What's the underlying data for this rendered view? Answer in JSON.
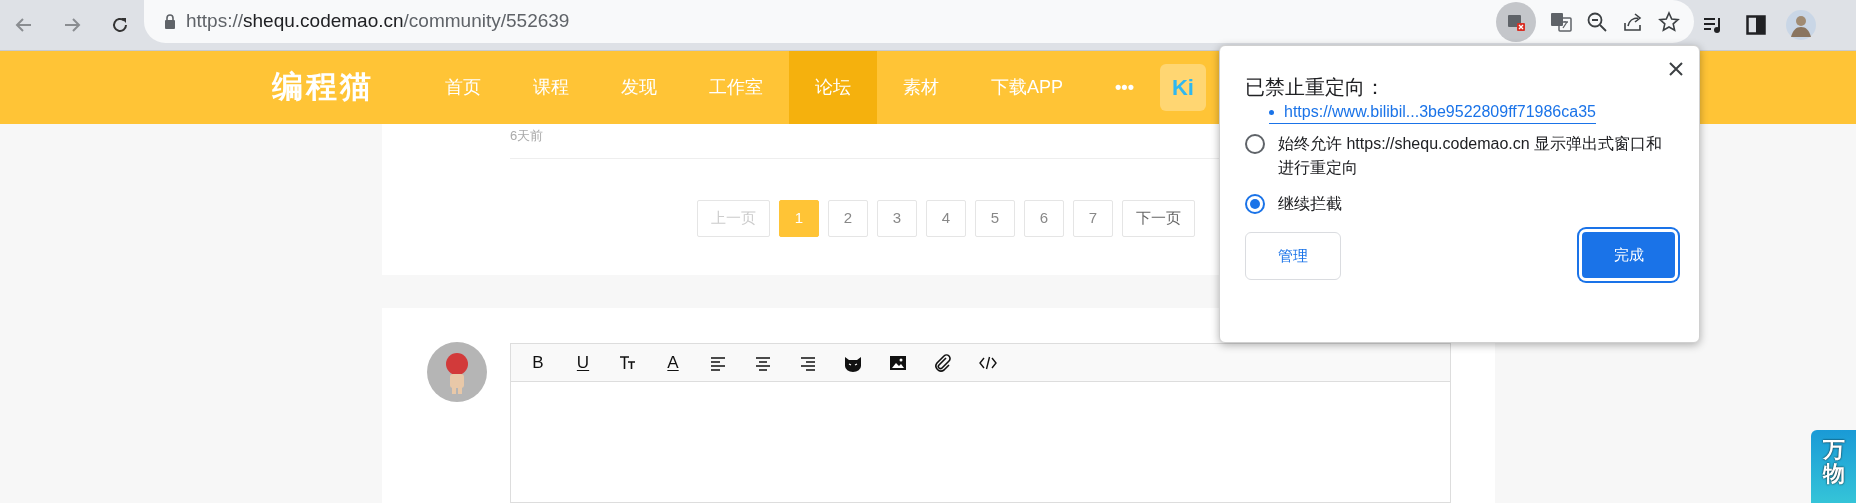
{
  "browser": {
    "url_scheme": "https://",
    "url_host": "shequ.codemao.cn",
    "url_path": "/community/552639"
  },
  "nav": {
    "logo": "编程猫",
    "items": [
      {
        "label": "首页",
        "selected": false
      },
      {
        "label": "课程",
        "selected": false
      },
      {
        "label": "发现",
        "selected": false
      },
      {
        "label": "工作室",
        "selected": false
      },
      {
        "label": "论坛",
        "selected": true
      },
      {
        "label": "素材",
        "selected": false
      },
      {
        "label": "下载APP",
        "selected": false
      }
    ],
    "more": "•••",
    "kit": "Ki"
  },
  "post": {
    "time": "6天前"
  },
  "pagination": {
    "prev": {
      "label": "上一页",
      "disabled": true
    },
    "pages": [
      {
        "label": "1",
        "selected": true
      },
      {
        "label": "2",
        "selected": false
      },
      {
        "label": "3",
        "selected": false
      },
      {
        "label": "4",
        "selected": false
      },
      {
        "label": "5",
        "selected": false
      },
      {
        "label": "6",
        "selected": false
      },
      {
        "label": "7",
        "selected": false
      }
    ],
    "next": {
      "label": "下一页",
      "disabled": false
    }
  },
  "editor": {
    "tools": [
      {
        "kind": "bold",
        "label": "B"
      },
      {
        "kind": "underline",
        "label": "U"
      },
      {
        "kind": "size"
      },
      {
        "kind": "color",
        "label": "A"
      },
      {
        "kind": "align-left"
      },
      {
        "kind": "align-center"
      },
      {
        "kind": "align-right"
      },
      {
        "kind": "emoji"
      },
      {
        "kind": "image"
      },
      {
        "kind": "attach"
      },
      {
        "kind": "code"
      }
    ]
  },
  "popup": {
    "title": "已禁止重定向：",
    "link": "https://www.bilibil...3be9522809ff71986ca35",
    "options": [
      {
        "label": "始终允许 https://shequ.codemao.cn 显示弹出式窗口和进行重定向",
        "selected": false
      },
      {
        "label": "继续拦截",
        "selected": true
      }
    ],
    "manage": "管理",
    "done": "完成"
  },
  "side_badge": {
    "text": "万物"
  }
}
